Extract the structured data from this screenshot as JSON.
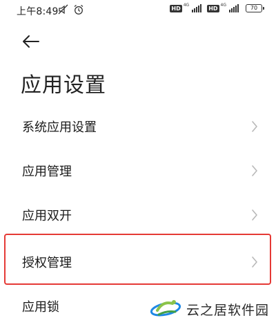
{
  "status_bar": {
    "time": "上午8:49",
    "hd_label_1": "HD",
    "net_label_1": "4G",
    "hd_label_2": "HD",
    "net_label_2": "4G",
    "battery": "70"
  },
  "header": {
    "title": "应用设置"
  },
  "settings": {
    "items": [
      {
        "label": "系统应用设置"
      },
      {
        "label": "应用管理"
      },
      {
        "label": "应用双开"
      },
      {
        "label": "授权管理"
      },
      {
        "label": "应用锁"
      }
    ]
  },
  "watermark": {
    "text": "云之居软件园"
  },
  "colors": {
    "highlight": "#e53935",
    "chevron": "#b8b8b8",
    "logo_blue": "#1e88e5",
    "logo_green": "#8bc34a"
  }
}
